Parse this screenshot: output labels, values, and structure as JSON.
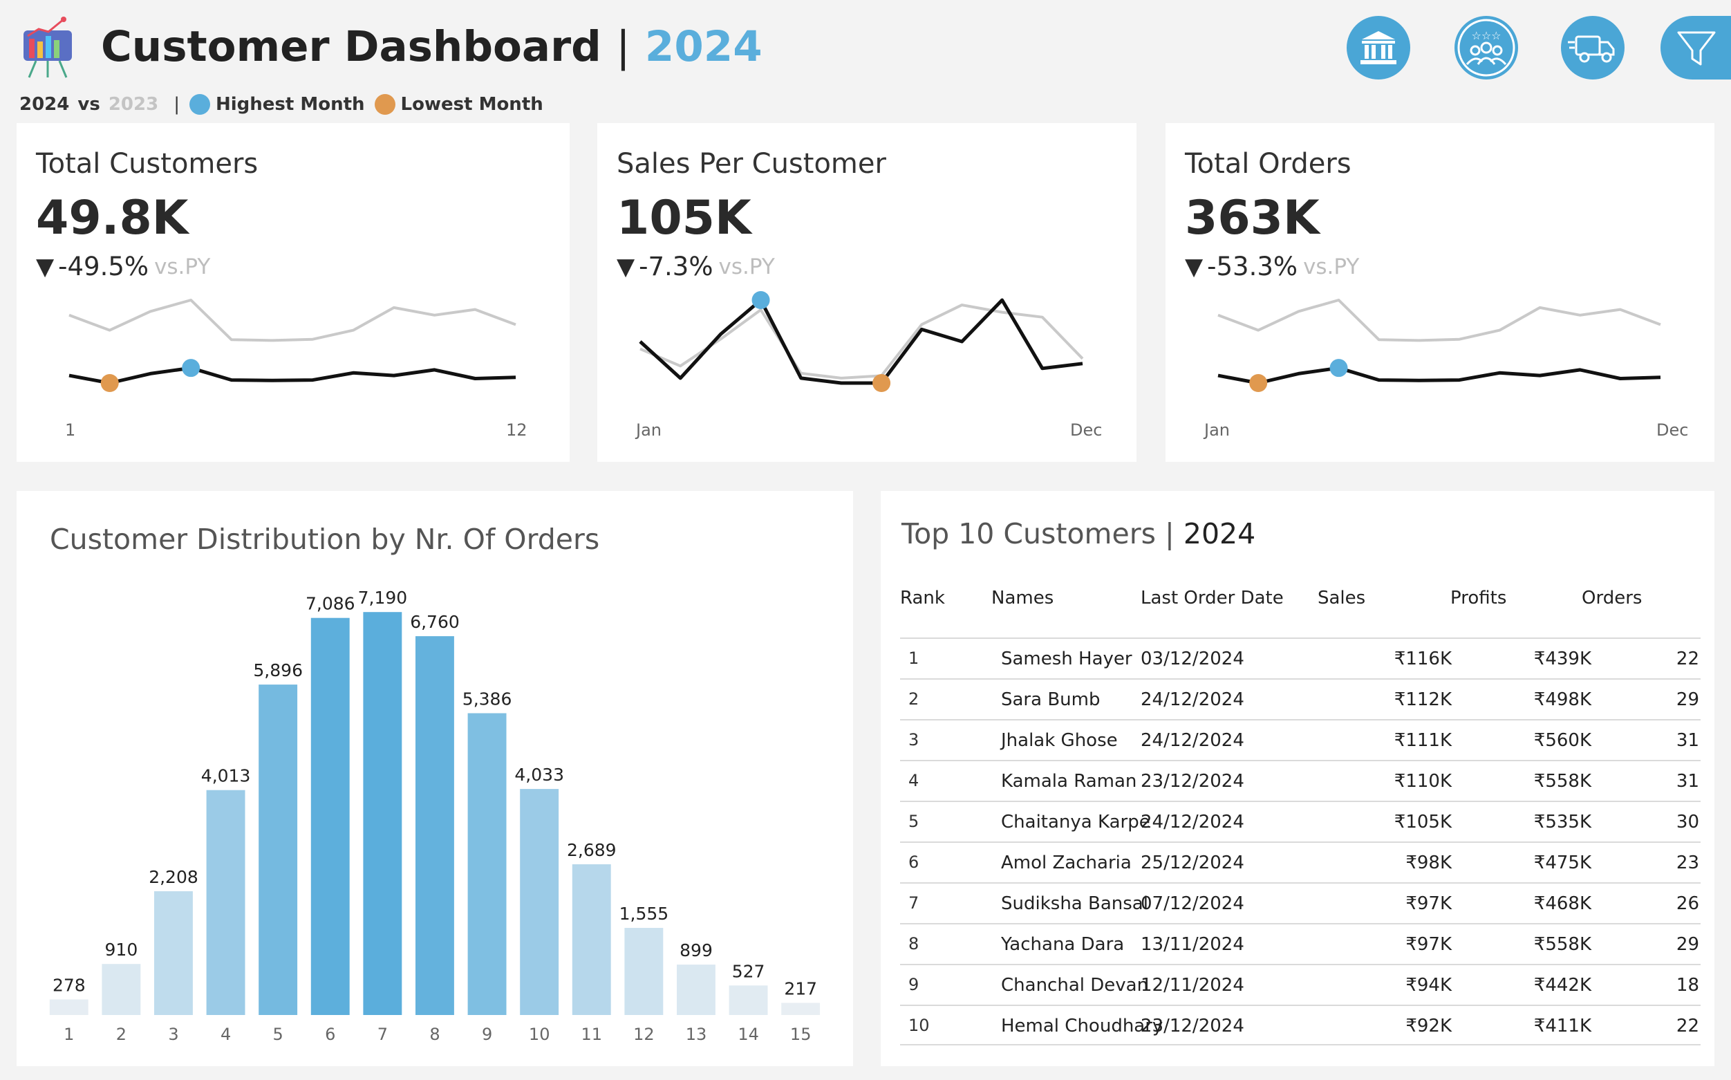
{
  "header": {
    "title": "Customer Dashboard",
    "separator": "|",
    "year": "2024",
    "icons": [
      "bank-icon",
      "customers-icon",
      "delivery-truck-icon",
      "filter-icon"
    ]
  },
  "legend": {
    "current_year": "2024",
    "vs": "vs",
    "previous_year": "2023",
    "separator": "|",
    "highest": "Highest Month",
    "lowest": "Lowest Month",
    "highest_color": "#5aaedc",
    "lowest_color": "#e0994f"
  },
  "kpis": [
    {
      "title": "Total Customers",
      "value": "49.8K",
      "delta": "-49.5%",
      "delta_suffix": "vs.PY",
      "axis_start": "1",
      "axis_end": "12",
      "current": [
        3.9,
        3.7,
        3.95,
        4.1,
        3.78,
        3.77,
        3.78,
        3.97,
        3.9,
        4.05,
        3.82,
        3.85
      ],
      "previous": [
        5.5,
        5.1,
        5.6,
        5.9,
        4.85,
        4.83,
        4.86,
        5.1,
        5.7,
        5.5,
        5.65,
        5.25
      ],
      "highest_index": 3,
      "lowest_index": 1
    },
    {
      "title": "Sales Per Customer",
      "value": "105K",
      "delta": "-7.3%",
      "delta_suffix": "vs.PY",
      "axis_start": "Jan",
      "axis_end": "Dec",
      "current": [
        6.45,
        6.3,
        6.48,
        6.62,
        6.3,
        6.28,
        6.28,
        6.5,
        6.45,
        6.62,
        6.34,
        6.36
      ],
      "previous": [
        6.42,
        6.35,
        6.46,
        6.58,
        6.32,
        6.3,
        6.31,
        6.52,
        6.6,
        6.57,
        6.55,
        6.38
      ],
      "highest_index": 3,
      "lowest_index": 6
    },
    {
      "title": "Total Orders",
      "value": "363K",
      "delta": "-53.3%",
      "delta_suffix": "vs.PY",
      "axis_start": "Jan",
      "axis_end": "Dec",
      "current": [
        3.9,
        3.7,
        3.95,
        4.1,
        3.78,
        3.77,
        3.78,
        3.97,
        3.9,
        4.05,
        3.82,
        3.85
      ],
      "previous": [
        5.5,
        5.1,
        5.6,
        5.9,
        4.85,
        4.83,
        4.86,
        5.1,
        5.7,
        5.5,
        5.65,
        5.25
      ],
      "highest_index": 3,
      "lowest_index": 1
    }
  ],
  "chart_data": {
    "type": "bar",
    "title": "Customer Distribution by Nr. Of Orders",
    "categories": [
      "1",
      "2",
      "3",
      "4",
      "5",
      "6",
      "7",
      "8",
      "9",
      "10",
      "11",
      "12",
      "13",
      "14",
      "15"
    ],
    "values": [
      278,
      910,
      2208,
      4013,
      5896,
      7086,
      7190,
      6760,
      5386,
      4033,
      2689,
      1555,
      899,
      527,
      217
    ],
    "data_labels": [
      "278",
      "910",
      "2,208",
      "4,013",
      "5,896",
      "7,086",
      "7,190",
      "6,760",
      "5,386",
      "4,033",
      "2,689",
      "1,555",
      "899",
      "527",
      "217"
    ],
    "ylim": [
      0,
      7600
    ],
    "grid": false
  },
  "top_customers": {
    "title": "Top 10 Customers",
    "separator": "|",
    "year": "2024",
    "headers": {
      "rank": "Rank",
      "names": "Names",
      "last_order_date": "Last Order Date",
      "sales": "Sales",
      "profits": "Profits",
      "orders": "Orders"
    },
    "rows": [
      {
        "rank": "1",
        "name": "Samesh Hayer",
        "date": "03/12/2024",
        "sales": "₹116K",
        "profits": "₹439K",
        "orders": "22"
      },
      {
        "rank": "2",
        "name": "Sara Bumb",
        "date": "24/12/2024",
        "sales": "₹112K",
        "profits": "₹498K",
        "orders": "29"
      },
      {
        "rank": "3",
        "name": "Jhalak Ghose",
        "date": "24/12/2024",
        "sales": "₹111K",
        "profits": "₹560K",
        "orders": "31"
      },
      {
        "rank": "4",
        "name": "Kamala Raman",
        "date": "23/12/2024",
        "sales": "₹110K",
        "profits": "₹558K",
        "orders": "31"
      },
      {
        "rank": "5",
        "name": "Chaitanya Karpe",
        "date": "24/12/2024",
        "sales": "₹105K",
        "profits": "₹535K",
        "orders": "30"
      },
      {
        "rank": "6",
        "name": "Amol Zacharia",
        "date": "25/12/2024",
        "sales": "₹98K",
        "profits": "₹475K",
        "orders": "23"
      },
      {
        "rank": "7",
        "name": "Sudiksha Bansal",
        "date": "07/12/2024",
        "sales": "₹97K",
        "profits": "₹468K",
        "orders": "26"
      },
      {
        "rank": "8",
        "name": "Yachana Dara",
        "date": "13/11/2024",
        "sales": "₹97K",
        "profits": "₹558K",
        "orders": "29"
      },
      {
        "rank": "9",
        "name": "Chanchal Devan",
        "date": "12/11/2024",
        "sales": "₹94K",
        "profits": "₹442K",
        "orders": "18"
      },
      {
        "rank": "10",
        "name": "Hemal Choudhary",
        "date": "23/12/2024",
        "sales": "₹92K",
        "profits": "₹411K",
        "orders": "22"
      }
    ]
  }
}
